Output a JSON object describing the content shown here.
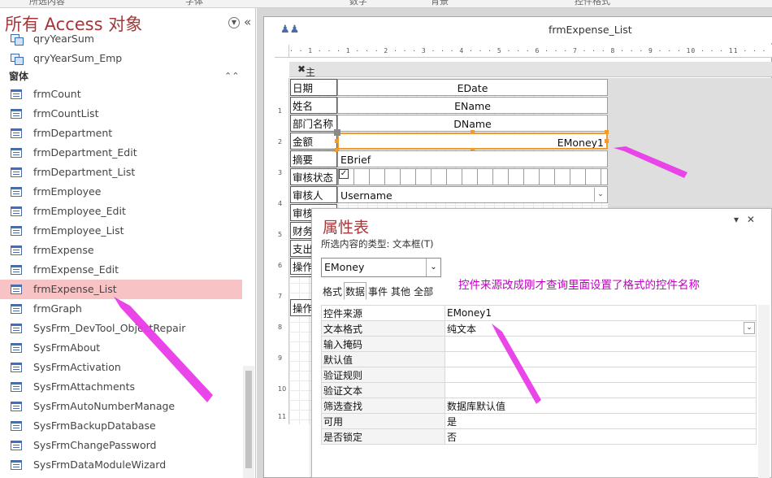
{
  "ribbon": {
    "groups": [
      "所选内容",
      "字体",
      "数字",
      "背景",
      "控件格式"
    ]
  },
  "nav": {
    "title": "所有 Access 对象",
    "dropdown_icon": "chevron-down-circle-icon",
    "collapse_label": "«",
    "queries": [
      "qryYearSum",
      "qryYearSum_Emp"
    ],
    "group_label": "窗体",
    "group_chevron": "⌃",
    "forms": [
      "frmCount",
      "frmCountList",
      "frmDepartment",
      "frmDepartment_Edit",
      "frmDepartment_List",
      "frmEmployee",
      "frmEmployee_Edit",
      "frmEmployee_List",
      "frmExpense",
      "frmExpense_Edit",
      "frmExpense_List",
      "frmGraph",
      "SysFrm_DevTool_ObjectRepair",
      "SysFrmAbout",
      "SysFrmActivation",
      "SysFrmAttachments",
      "SysFrmAutoNumberManage",
      "SysFrmBackupDatabase",
      "SysFrmChangePassword",
      "SysFrmDataModuleWizard"
    ],
    "selected": "frmExpense_List"
  },
  "form_window": {
    "title": "frmExpense_List",
    "ruler": "· · 1 · · · 1 · · · 2 · · · 3 · · · 4 · · · 5 · · · 6 · · · 7 · · · 8 · · · 9 · · · 10 · · · 11 · · · 12 · · · 13 · · · 14 · · · 15",
    "section": "主体",
    "vruler": [
      "1",
      "2",
      "3",
      "4",
      "5",
      "6",
      "7",
      "8",
      "9",
      "10",
      "11"
    ]
  },
  "form_fields": [
    {
      "label": "日期",
      "control": "EDate"
    },
    {
      "label": "姓名",
      "control": "EName"
    },
    {
      "label": "部门名称",
      "control": "DName"
    },
    {
      "label": "金额",
      "control": "EMoney1"
    },
    {
      "label": "摘要",
      "control": "EBrief"
    },
    {
      "label": "审核状态",
      "control": "✓"
    },
    {
      "label": "审核人",
      "control": "Username"
    },
    {
      "label": "审核",
      "control": ""
    },
    {
      "label": "财务",
      "control": ""
    },
    {
      "label": "支出",
      "control": ""
    },
    {
      "label": "操作",
      "control": ""
    },
    {
      "label": "操作",
      "control": ""
    }
  ],
  "property_sheet": {
    "title": "属性表",
    "controls": [
      "▾",
      "✕"
    ],
    "selection_type": "所选内容的类型: 文本框(T)",
    "selected_control": "EMoney",
    "tabs": [
      "格式",
      "数据",
      "事件",
      "其他",
      "全部"
    ],
    "active_tab": "数据",
    "annotation": "控件来源改成刚才查询里面设置了格式的控件名称",
    "annotation_color": "#c000c0",
    "rows": [
      {
        "name": "控件来源",
        "value": "EMoney1"
      },
      {
        "name": "文本格式",
        "value": "纯文本"
      },
      {
        "name": "输入掩码",
        "value": ""
      },
      {
        "name": "默认值",
        "value": ""
      },
      {
        "name": "验证规则",
        "value": ""
      },
      {
        "name": "验证文本",
        "value": ""
      },
      {
        "name": "筛选查找",
        "value": "数据库默认值"
      },
      {
        "name": "可用",
        "value": "是"
      },
      {
        "name": "是否锁定",
        "value": "否"
      }
    ]
  },
  "colors": {
    "accent_title": "#a4373a",
    "selection_highlight": "#f8c3c5",
    "selected_control_border": "#f29b2c",
    "arrow": "#e83be8"
  }
}
